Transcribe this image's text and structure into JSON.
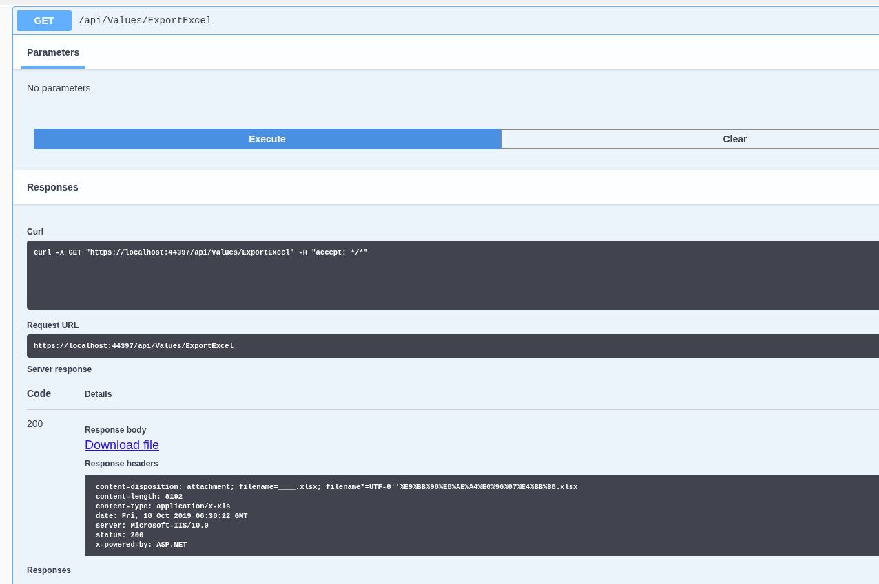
{
  "operation": {
    "kind": "get",
    "method": "GET",
    "path": "/api/Values/ExportExcel"
  },
  "tabs": [
    {
      "label": "Parameters",
      "selected": true
    }
  ],
  "parameters_note": "No parameters",
  "buttons": [
    {
      "label": "Execute",
      "kind": "execute"
    },
    {
      "label": "Clear",
      "kind": "clear"
    }
  ],
  "responses_heading": "Responses",
  "curl": {
    "label": "Curl",
    "command": "curl -X GET \"https://localhost:44397/api/Values/ExportExcel\" -H \"accept: */*\""
  },
  "request_url": {
    "label": "Request URL",
    "value": "https://localhost:44397/api/Values/ExportExcel"
  },
  "server_response": {
    "label": "Server response",
    "columns": [
      "Code",
      "Details"
    ],
    "rows": [
      {
        "code": "200",
        "body_label": "Response body",
        "download_link": "Download file",
        "headers_label": "Response headers",
        "headers": [
          "content-disposition: attachment; filename=____.xlsx; filename*=UTF-8''%E9%BB%98%E8%AE%A4%E6%96%87%E4%BB%B6.xlsx",
          "content-length: 8192",
          "content-type: application/x-xls",
          "date: Fri, 18 Oct 2019 06:38:22 GMT",
          "server: Microsoft-IIS/10.0",
          "status: 200",
          "x-powered-by: ASP.NET"
        ]
      }
    ]
  },
  "responses_footer": "Responses"
}
